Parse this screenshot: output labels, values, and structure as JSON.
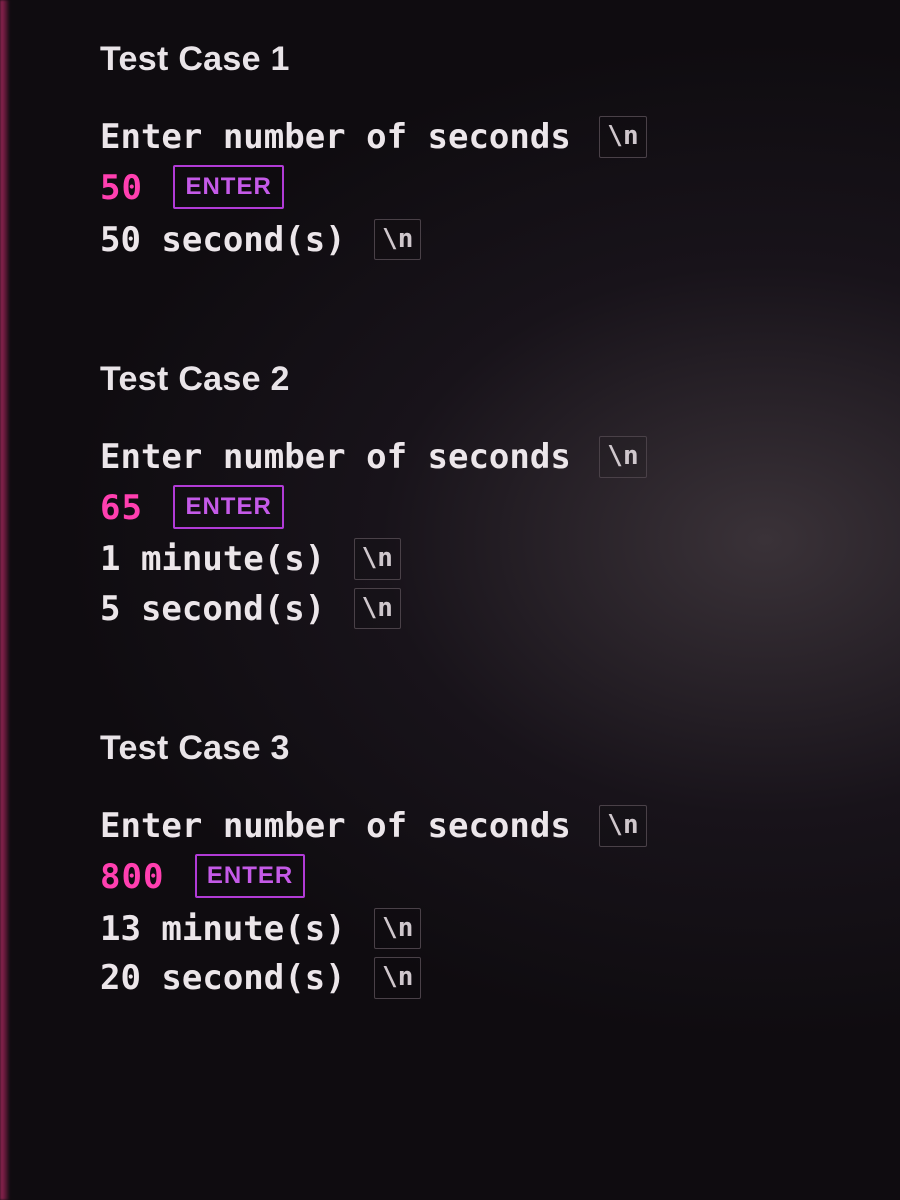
{
  "badges": {
    "newline": "\\n",
    "enter": "ENTER"
  },
  "cases": [
    {
      "title": "Test Case 1",
      "prompt": "Enter number of seconds",
      "input": "50",
      "outputs": [
        "50 second(s)"
      ]
    },
    {
      "title": "Test Case 2",
      "prompt": "Enter number of seconds",
      "input": "65",
      "outputs": [
        "1 minute(s)",
        "5 second(s)"
      ]
    },
    {
      "title": "Test Case 3",
      "prompt": "Enter number of seconds",
      "input": "800",
      "outputs": [
        "13 minute(s)",
        "20 second(s)"
      ]
    }
  ]
}
